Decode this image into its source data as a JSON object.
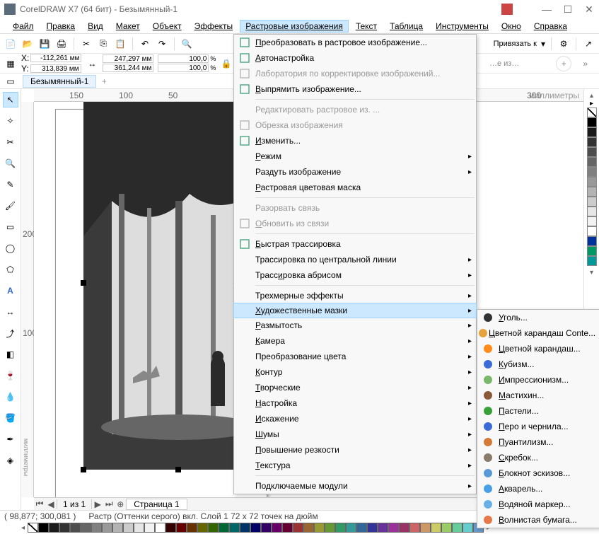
{
  "title": "CorelDRAW X7 (64 бит) - Безымянный-1",
  "menubar": [
    "Файл",
    "Правка",
    "Вид",
    "Макет",
    "Объект",
    "Эффекты",
    "Растровые изображения",
    "Текст",
    "Таблица",
    "Инструменты",
    "Окно",
    "Справка"
  ],
  "snap_label": "Привязать к",
  "coords": {
    "x_label": "X:",
    "x": "-112,261 мм",
    "y_label": "Y:",
    "y": "313,839 мм",
    "w": "247,297 мм",
    "h": "361,244 мм",
    "sx": "100,0",
    "sy": "100,0"
  },
  "doc_tab": "Безымянный-1",
  "ruler_unit": "миллиметры",
  "ruler_h": [
    "150",
    "100",
    "50",
    "",
    "300"
  ],
  "ruler_v": [
    "200",
    "100"
  ],
  "page_nav": {
    "ind": "1 из 1",
    "tab": "Страница 1"
  },
  "right_dock_label": "…е из…",
  "status": {
    "cursor": "( 98,877; 300,081 )",
    "info": "Растр (Оттенки серого) вкл. Слой 1 72 x 72 точек на дюйм",
    "fill_none": "Нет",
    "outline_none": "Нет"
  },
  "menu_bitmaps": [
    {
      "label": "Преобразовать в растровое изображение...",
      "icon": "convert-bitmap-icon",
      "u": 0
    },
    {
      "label": "Автонастройка",
      "icon": "auto-adjust-icon",
      "u": 0
    },
    {
      "label": "Лаборатория по корректировке изображений...",
      "icon": "image-lab-icon",
      "disabled": true
    },
    {
      "label": "Выпрямить изображение...",
      "icon": "straighten-icon",
      "u": 0
    },
    {
      "sep": true
    },
    {
      "label": "Редактировать растровое из. ...",
      "disabled": true
    },
    {
      "label": "Обрезка изображения",
      "icon": "crop-icon",
      "disabled": true
    },
    {
      "label": "Изменить...",
      "icon": "resample-icon",
      "u": 0
    },
    {
      "label": "Режим",
      "u": 0,
      "arrow": true
    },
    {
      "label": "Раздуть изображение",
      "arrow": true
    },
    {
      "label": "Растровая цветовая маска",
      "u": 0
    },
    {
      "sep": true
    },
    {
      "label": "Разорвать связь",
      "disabled": true
    },
    {
      "label": "Обновить из связи",
      "icon": "update-link-icon",
      "disabled": true,
      "u": 0
    },
    {
      "sep": true
    },
    {
      "label": "Быстрая трассировка",
      "icon": "quick-trace-icon",
      "u": 0
    },
    {
      "label": "Трассировка по центральной линии",
      "arrow": true
    },
    {
      "label": "Трассировка абрисом",
      "u": 5,
      "arrow": true
    },
    {
      "sep": true
    },
    {
      "label": "Трехмерные эффекты",
      "arrow": true
    },
    {
      "label": "Художественные мазки",
      "u": 0,
      "arrow": true,
      "highlight": true
    },
    {
      "label": "Размытость",
      "u": 0,
      "arrow": true
    },
    {
      "label": "Камера",
      "u": 0,
      "arrow": true
    },
    {
      "label": "Преобразование цвета",
      "arrow": true
    },
    {
      "label": "Контур",
      "u": 0,
      "arrow": true
    },
    {
      "label": "Творческие",
      "u": 0,
      "arrow": true
    },
    {
      "label": "Настройка",
      "u": 0,
      "arrow": true
    },
    {
      "label": "Искажение",
      "u": 0,
      "arrow": true
    },
    {
      "label": "Шумы",
      "u": 0,
      "arrow": true
    },
    {
      "label": "Повышение резкости",
      "u": 0,
      "arrow": true
    },
    {
      "label": "Текстура",
      "u": 0,
      "arrow": true
    },
    {
      "sep": true
    },
    {
      "label": "Подключаемые модули",
      "arrow": true
    }
  ],
  "menu_art": [
    {
      "label": "Уголь...",
      "icon": "charcoal-icon",
      "color": "#333"
    },
    {
      "label": "Цветной карандаш Conte...",
      "icon": "conte-icon",
      "color": "#e6a23c"
    },
    {
      "label": "Цветной карандаш...",
      "icon": "crayon-icon",
      "color": "#ff8c1a"
    },
    {
      "label": "Кубизм...",
      "icon": "cubism-icon",
      "color": "#3a6bd6"
    },
    {
      "label": "Импрессионизм...",
      "icon": "impressionism-icon",
      "color": "#7ab86c"
    },
    {
      "label": "Мастихин...",
      "icon": "palette-knife-icon",
      "color": "#8a5a3a"
    },
    {
      "label": "Пастели...",
      "icon": "pastels-icon",
      "color": "#3aa03a"
    },
    {
      "label": "Перо и чернила...",
      "icon": "pen-ink-icon",
      "color": "#3a6bd6"
    },
    {
      "label": "Пуантилизм...",
      "icon": "pointillism-icon",
      "color": "#d67a3a"
    },
    {
      "label": "Скребок...",
      "icon": "scraper-icon",
      "color": "#8a7a6a"
    },
    {
      "label": "Блокнот эскизов...",
      "icon": "sketchpad-icon",
      "color": "#5a9ad6"
    },
    {
      "label": "Акварель...",
      "icon": "watercolor-icon",
      "color": "#4aa0e6"
    },
    {
      "label": "Водяной маркер...",
      "icon": "watermarker-icon",
      "color": "#6ab0e6"
    },
    {
      "label": "Волнистая бумага...",
      "icon": "wavepaper-icon",
      "color": "#e67a4a"
    }
  ],
  "palette_colors": [
    "#000000",
    "#1a1a1a",
    "#333333",
    "#4d4d4d",
    "#666666",
    "#808080",
    "#999999",
    "#b3b3b3",
    "#cccccc",
    "#e6e6e6",
    "#f2f2f2",
    "#ffffff",
    "#003399",
    "#009966",
    "#009999"
  ],
  "bottom_colors": [
    "#000",
    "#1a1a1a",
    "#333",
    "#4d4d4d",
    "#666",
    "#808080",
    "#999",
    "#b3b3b3",
    "#ccc",
    "#e6e6e6",
    "#f2f2f2",
    "#fff",
    "#330000",
    "#660000",
    "#663300",
    "#666600",
    "#336600",
    "#006633",
    "#006666",
    "#003366",
    "#000066",
    "#330066",
    "#660066",
    "#660033",
    "#993333",
    "#996633",
    "#999933",
    "#669933",
    "#339966",
    "#339999",
    "#336699",
    "#333399",
    "#663399",
    "#993399",
    "#993366",
    "#cc6666",
    "#cc9966",
    "#cccc66",
    "#99cc66",
    "#66cc99",
    "#66cccc",
    "#6699cc"
  ]
}
